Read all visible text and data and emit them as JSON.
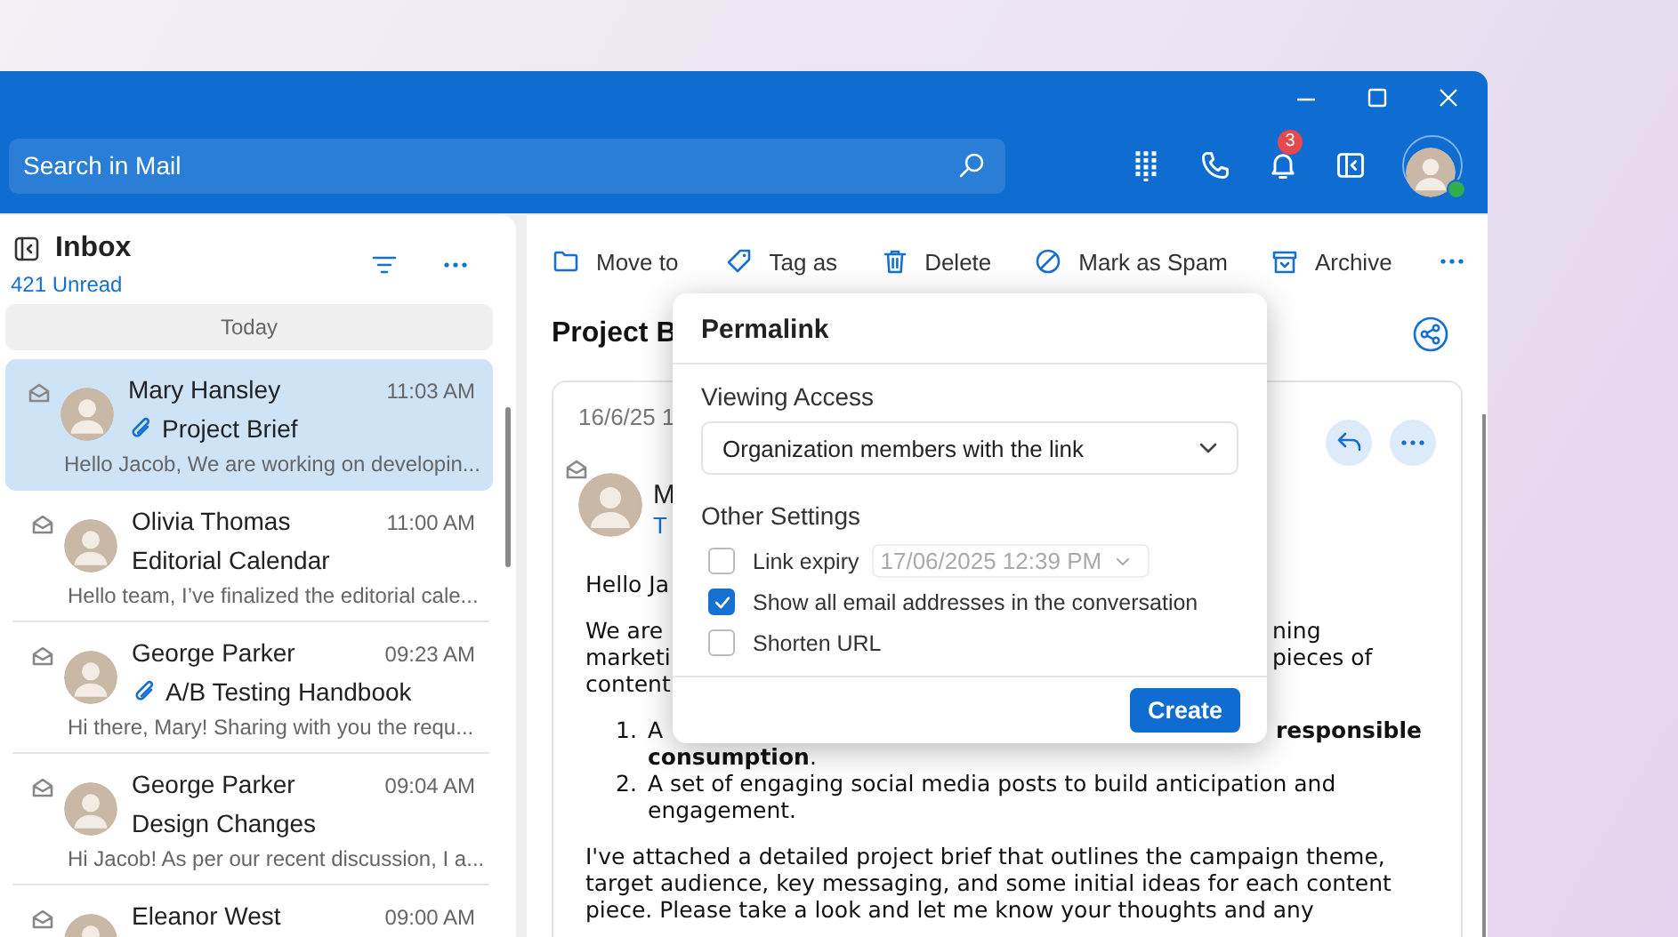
{
  "search": {
    "placeholder": "Search in Mail"
  },
  "header": {
    "notification_count": "3",
    "online": true
  },
  "mail_list": {
    "title": "Inbox",
    "unread": "421 Unread",
    "group": "Today",
    "items": [
      {
        "sender": "Mary Hansley",
        "time": "11:03 AM",
        "subject": "Project Brief",
        "preview": "Hello Jacob, We are working on developin...",
        "attachment": true,
        "selected": true
      },
      {
        "sender": "Olivia Thomas",
        "time": "11:00 AM",
        "subject": "Editorial Calendar",
        "preview": "Hello team, I’ve finalized the editorial cale...",
        "attachment": false,
        "selected": false
      },
      {
        "sender": "George Parker",
        "time": "09:23 AM",
        "subject": "A/B Testing Handbook",
        "preview": "Hi there, Mary! Sharing with you the requ...",
        "attachment": true,
        "selected": false
      },
      {
        "sender": "George Parker",
        "time": "09:04 AM",
        "subject": "Design Changes",
        "preview": "Hi Jacob! As per our recent discussion, I a...",
        "attachment": false,
        "selected": false
      },
      {
        "sender": "Eleanor West",
        "time": "09:00 AM",
        "selected": false
      }
    ]
  },
  "toolbar": [
    "Move to",
    "Tag as",
    "Delete",
    "Mark as Spam",
    "Archive"
  ],
  "reading_pane": {
    "subject": "Project B",
    "date": "16/6/25 1",
    "sender": "M",
    "to": "T",
    "body": [
      {
        "kind": "para",
        "lines": [
          {
            "left": "Hello Ja"
          }
        ]
      },
      {
        "kind": "para",
        "lines": [
          {
            "left": "We are",
            "right": "ning"
          },
          {
            "left": "marketi",
            "right": "pieces of"
          },
          {
            "left": "content"
          }
        ]
      },
      {
        "kind": "list",
        "items": [
          {
            "number": "1.",
            "lines": [
              {
                "left": "A",
                "right": "**responsible**"
              },
              {
                "left": "**consumption**."
              }
            ]
          },
          {
            "number": "2.",
            "lines": [
              {
                "left": "A set of engaging social media posts to build anticipation and"
              },
              {
                "left": "engagement."
              }
            ]
          }
        ]
      },
      {
        "kind": "para",
        "lines": [
          {
            "left": "I've attached a detailed project brief that outlines the campaign theme,"
          },
          {
            "left": "target audience, key messaging, and some initial ideas for each content"
          },
          {
            "left": "piece. Please take a look and let me know your thoughts and any"
          }
        ]
      }
    ]
  },
  "dialog": {
    "title": "Permalink",
    "access_label": "Viewing Access",
    "access_value": "Organization members with the link",
    "settings_label": "Other Settings",
    "options": [
      {
        "kind": "expiry",
        "label": "Link expiry",
        "checked": false,
        "date": "17/06/2025 12:39 PM"
      },
      {
        "kind": "checkbox",
        "label": "Show all email addresses in the conversation",
        "checked": true
      },
      {
        "kind": "checkbox",
        "label": "Shorten URL",
        "checked": false
      }
    ],
    "button": "Create"
  }
}
